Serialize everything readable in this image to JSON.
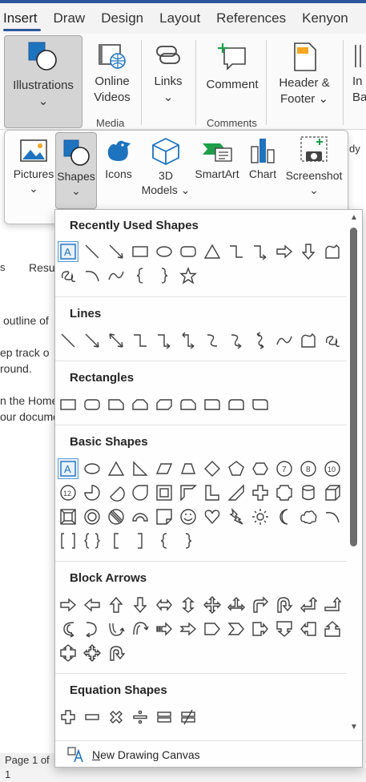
{
  "colors": {
    "accent": "#2b579a",
    "icon_blue": "#1e73be",
    "shape_stroke": "#404040"
  },
  "tabs": [
    "Insert",
    "Draw",
    "Design",
    "Layout",
    "References",
    "Kenyon"
  ],
  "ribbon": {
    "illustrations": {
      "label": "Illustrations"
    },
    "online_videos": {
      "label1": "Online",
      "label2": "Videos"
    },
    "links": {
      "label": "Links"
    },
    "comment": {
      "label": "Comment"
    },
    "header_footer": {
      "label1": "Header &",
      "label2": "Footer"
    },
    "cutoff": {
      "label1": "In",
      "label2": "Bar"
    },
    "groups": {
      "media": "Media",
      "comments": "Comments"
    }
  },
  "illustrations_panel": {
    "pictures": "Pictures",
    "shapes": "Shapes",
    "icons": "Icons",
    "models_3d": {
      "label1": "3D",
      "label2": "Models"
    },
    "smartart": "SmartArt",
    "chart": "Chart",
    "screenshot": "Screenshot"
  },
  "document": {
    "lines": [
      "Resu",
      "outline of",
      "ep track o",
      "round.",
      "n the Home",
      "our docume"
    ],
    "side_mark": "dy",
    "page_status": "Page 1 of 1"
  },
  "gallery": {
    "sections": {
      "recent": {
        "title": "Recently Used Shapes",
        "icons": [
          "text-box",
          "line",
          "arrow-line",
          "rectangle",
          "oval",
          "rounded-rectangle",
          "triangle",
          "elbow-connector",
          "elbow-arrow-connector",
          "right-arrow",
          "down-arrow",
          "freeform",
          "scribble",
          "arc",
          "curve",
          "left-brace",
          "right-brace",
          "star"
        ]
      },
      "lines": {
        "title": "Lines",
        "icons": [
          "line",
          "arrow-line",
          "double-arrow-line",
          "elbow-connector",
          "elbow-arrow-connector",
          "elbow-double-arrow",
          "curved-connector",
          "curved-arrow",
          "curved-double-arrow",
          "curve",
          "freeform",
          "scribble"
        ]
      },
      "rectangles": {
        "title": "Rectangles",
        "icons": [
          "rectangle",
          "rounded-rectangle",
          "snip-single-corner",
          "snip-same-side",
          "snip-diagonal",
          "snip-round-corner",
          "round-single-corner",
          "round-same-side",
          "round-diagonal"
        ]
      },
      "basic": {
        "title": "Basic Shapes",
        "icons": [
          "text-box",
          "oval",
          "isosceles-triangle",
          "right-triangle",
          "parallelogram",
          "trapezoid",
          "diamond",
          "pentagon",
          "hexagon",
          "heptagon-7",
          "octagon-8",
          "decagon-10",
          "dodecagon-12",
          "pie",
          "chord",
          "teardrop",
          "frame",
          "half-frame",
          "l-shape",
          "diagonal-stripe",
          "cross",
          "plaque",
          "can",
          "cube",
          "bevel",
          "donut",
          "no-symbol",
          "block-arc",
          "folded-corner",
          "smiley",
          "heart",
          "lightning",
          "sun",
          "moon",
          "cloud",
          "arc",
          "double-bracket",
          "double-brace",
          "left-bracket",
          "right-bracket",
          "left-brace",
          "right-brace"
        ]
      },
      "block_arrows": {
        "title": "Block Arrows",
        "icons": [
          "right-arrow",
          "left-arrow",
          "up-arrow",
          "down-arrow",
          "left-right-arrow",
          "up-down-arrow",
          "quad-arrow",
          "left-right-up-arrow",
          "bent-arrow",
          "u-turn-arrow",
          "left-up-arrow",
          "bent-up-arrow",
          "curved-right-arrow",
          "curved-left-arrow",
          "curved-up-arrow",
          "curved-down-arrow",
          "striped-right-arrow",
          "notched-right-arrow",
          "pentagon-arrow",
          "chevron",
          "right-arrow-callout",
          "down-arrow-callout",
          "left-arrow-callout",
          "up-arrow-callout",
          "up-down-callout",
          "quad-arrow-callout",
          "circular-arrow"
        ]
      },
      "equation": {
        "title": "Equation Shapes",
        "icons": [
          "plus",
          "minus",
          "multiply",
          "division",
          "equal",
          "not-equal"
        ]
      }
    },
    "new_canvas": {
      "label_u": "N",
      "label_rest": "ew Drawing Canvas"
    }
  }
}
